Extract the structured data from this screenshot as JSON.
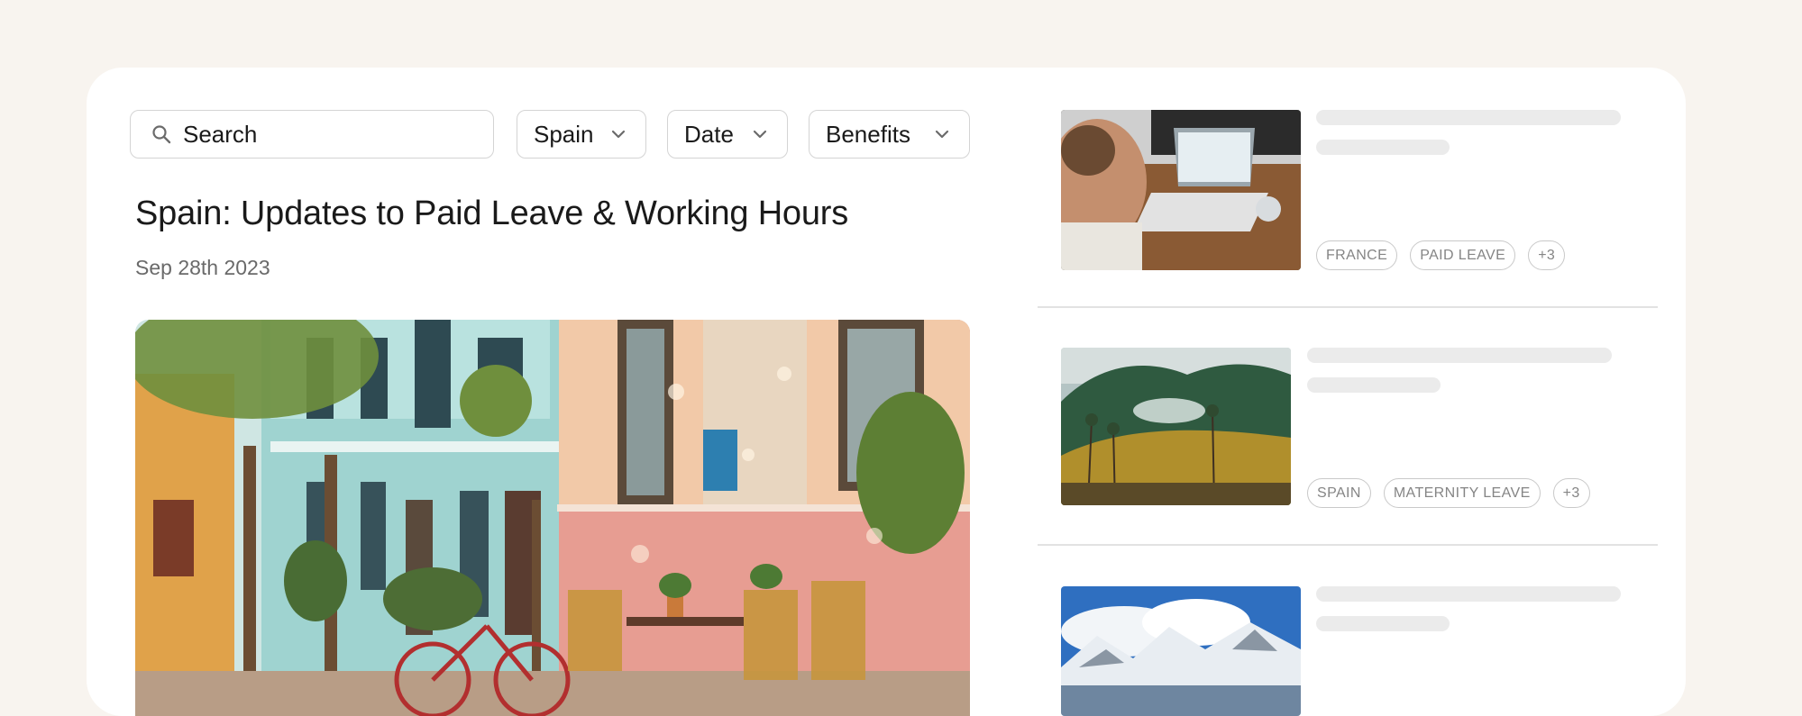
{
  "search": {
    "placeholder": "Search"
  },
  "filters": [
    {
      "label": "Spain"
    },
    {
      "label": "Date"
    },
    {
      "label": "Benefits"
    }
  ],
  "article": {
    "title": "Spain: Updates to Paid Leave & Working Hours",
    "date": "Sep 28th 2023"
  },
  "list": [
    {
      "thumbnail": "person-at-laptop-image",
      "tags": [
        "FRANCE",
        "PAID LEAVE",
        "+3"
      ]
    },
    {
      "thumbnail": "misty-palm-valley-image",
      "tags": [
        "SPAIN",
        "MATERNITY LEAVE",
        "+3"
      ]
    },
    {
      "thumbnail": "snowy-mountains-image",
      "tags": []
    }
  ],
  "colors": {
    "page_background": "#f8f4ef",
    "card_background": "#ffffff",
    "skeleton": "#ebebeb",
    "tag_text": "#858585"
  }
}
